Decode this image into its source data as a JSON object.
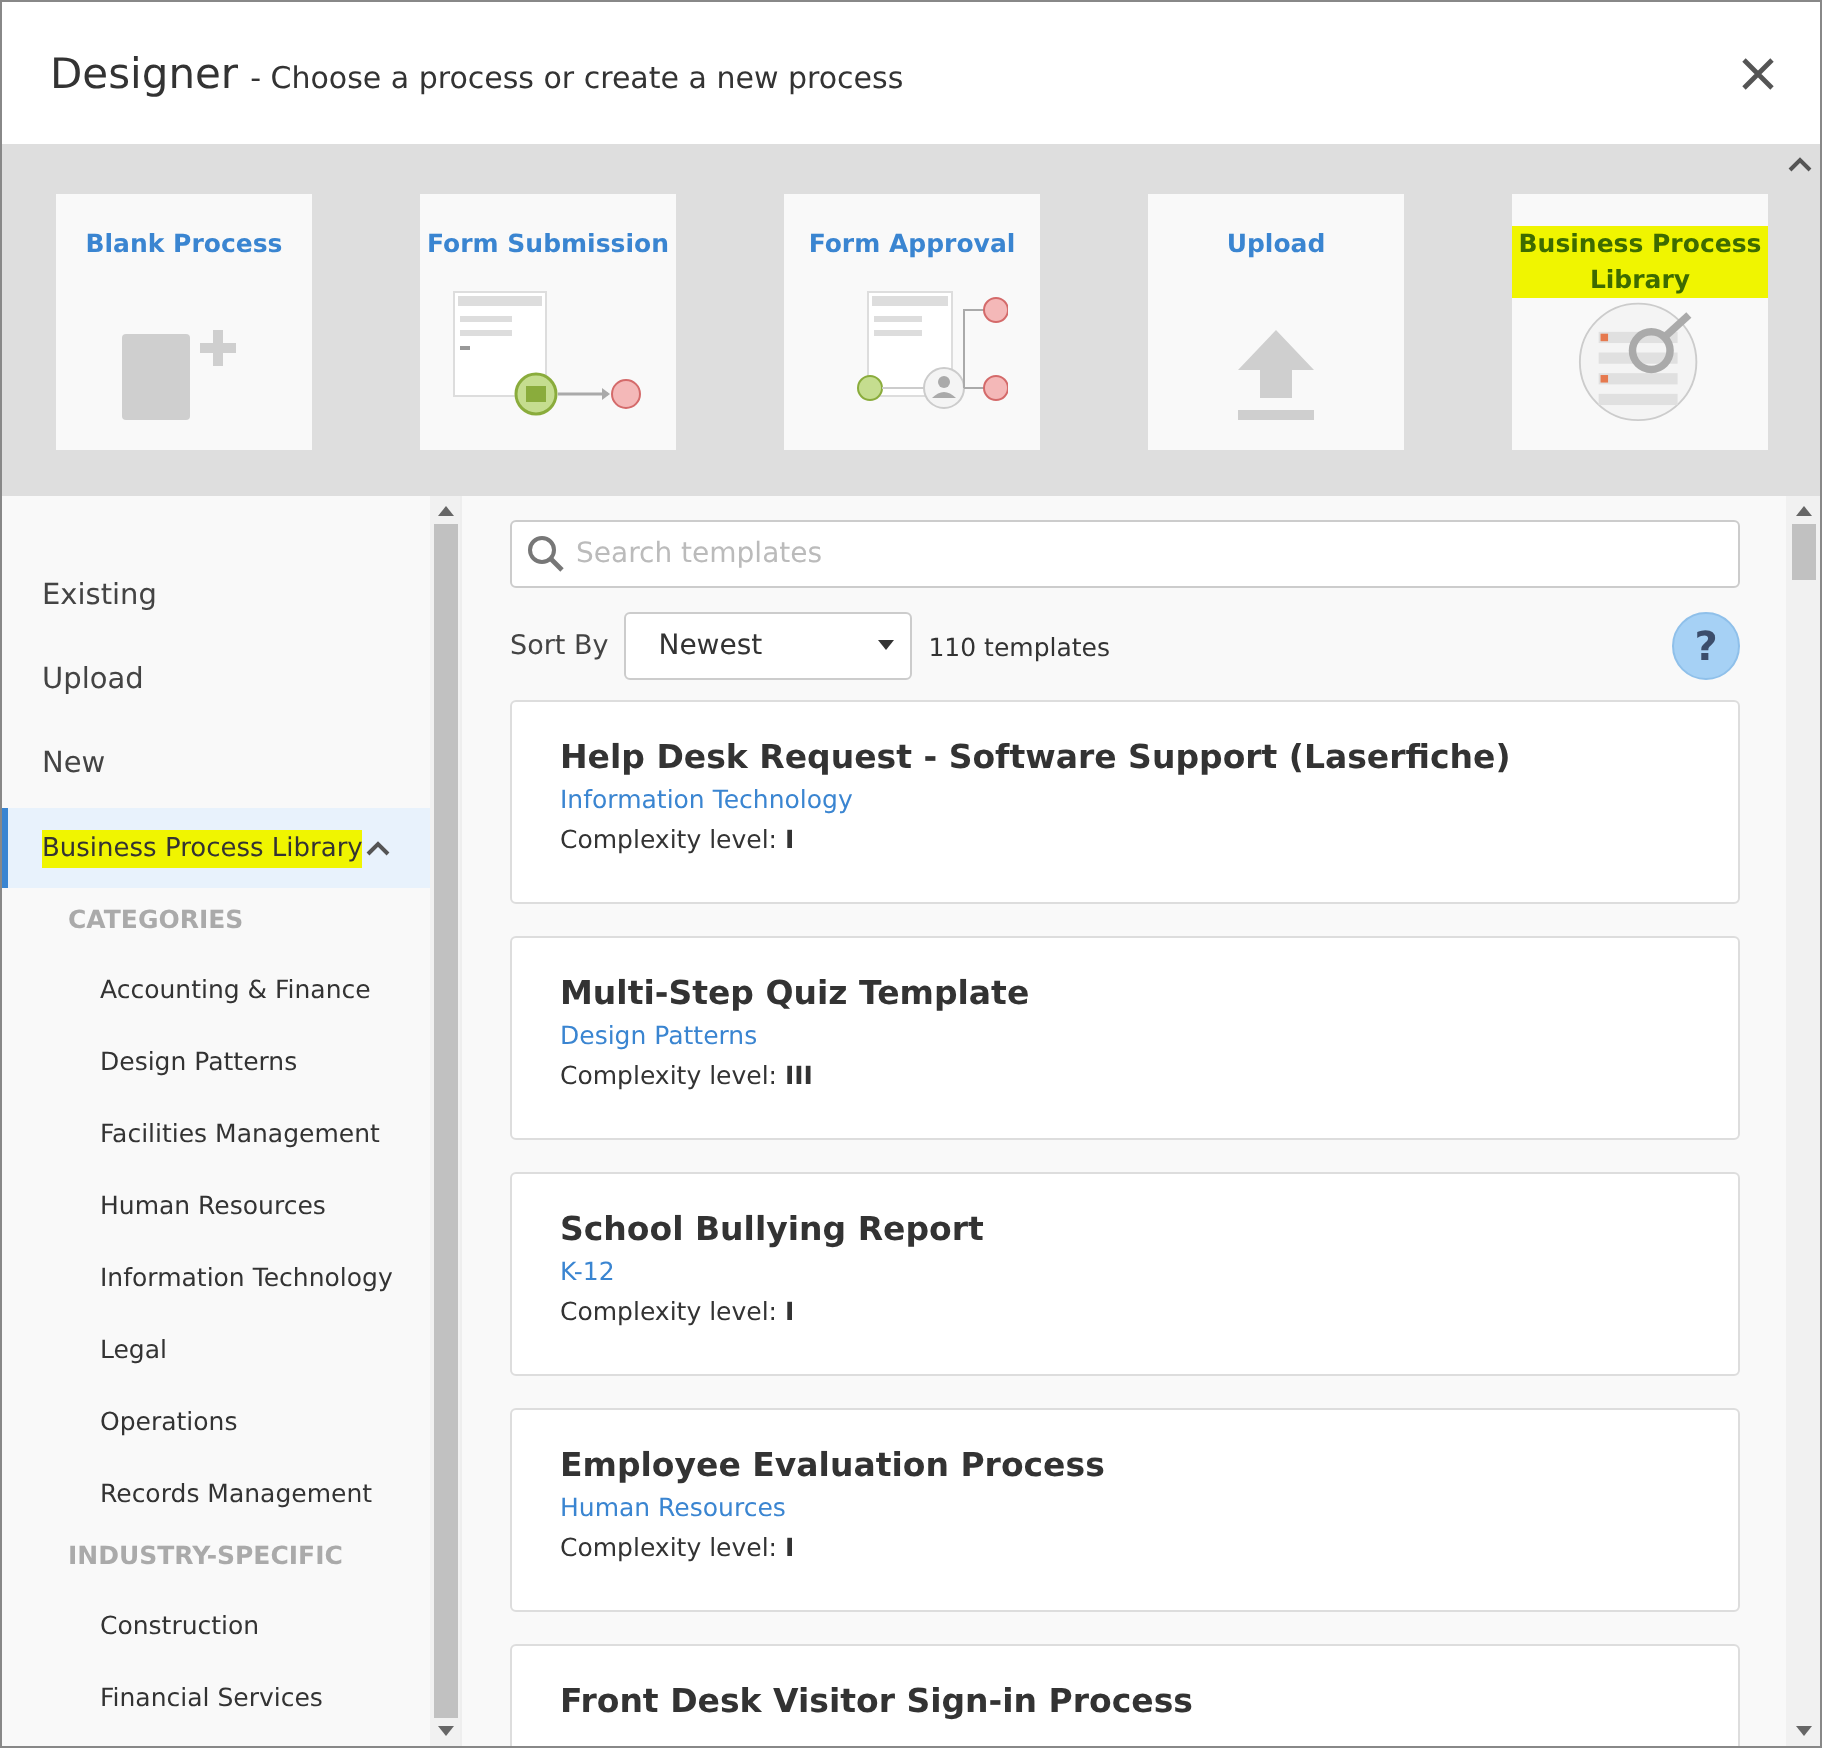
{
  "window": {
    "title": "Designer",
    "subtitle": "- Choose a process or create a new process"
  },
  "tiles": [
    {
      "kind": "blank",
      "label": "Blank Process",
      "highlighted": false
    },
    {
      "kind": "submission",
      "label": "Form Submission",
      "highlighted": false
    },
    {
      "kind": "approval",
      "label": "Form Approval",
      "highlighted": false
    },
    {
      "kind": "upload",
      "label": "Upload",
      "highlighted": false
    },
    {
      "kind": "library",
      "label": "Business Process Library",
      "highlighted": true
    }
  ],
  "sidebar": {
    "items": [
      {
        "label": "Existing",
        "selected": false,
        "highlighted": false
      },
      {
        "label": "Upload",
        "selected": false,
        "highlighted": false
      },
      {
        "label": "New",
        "selected": false,
        "highlighted": false
      },
      {
        "label": "Business Process Library",
        "selected": true,
        "highlighted": true,
        "expanded": true,
        "groups": [
          {
            "heading": "CATEGORIES",
            "children": [
              {
                "label": "Accounting & Finance"
              },
              {
                "label": "Design Patterns"
              },
              {
                "label": "Facilities Management"
              },
              {
                "label": "Human Resources"
              },
              {
                "label": "Information Technology"
              },
              {
                "label": "Legal"
              },
              {
                "label": "Operations"
              },
              {
                "label": "Records Management"
              }
            ]
          },
          {
            "heading": "INDUSTRY-SPECIFIC",
            "children": [
              {
                "label": "Construction"
              },
              {
                "label": "Financial Services"
              }
            ]
          }
        ]
      }
    ]
  },
  "search": {
    "placeholder": "Search templates"
  },
  "sort": {
    "label": "Sort By",
    "value": "Newest",
    "count": "110 templates"
  },
  "help": "?",
  "templates": [
    {
      "title": "Help Desk Request - Software Support (Laserfiche)",
      "category": "Information Technology",
      "complexity": "Complexity level: **I**"
    },
    {
      "title": "Multi-Step Quiz Template",
      "category": "Design Patterns",
      "complexity": "Complexity level: **III**"
    },
    {
      "title": "School Bullying Report",
      "category": "K-12",
      "complexity": "Complexity level: **I**"
    },
    {
      "title": "Employee Evaluation Process",
      "category": "Human Resources",
      "complexity": "Complexity level: **I**"
    },
    {
      "title": "Front Desk Visitor Sign-in Process"
    }
  ]
}
